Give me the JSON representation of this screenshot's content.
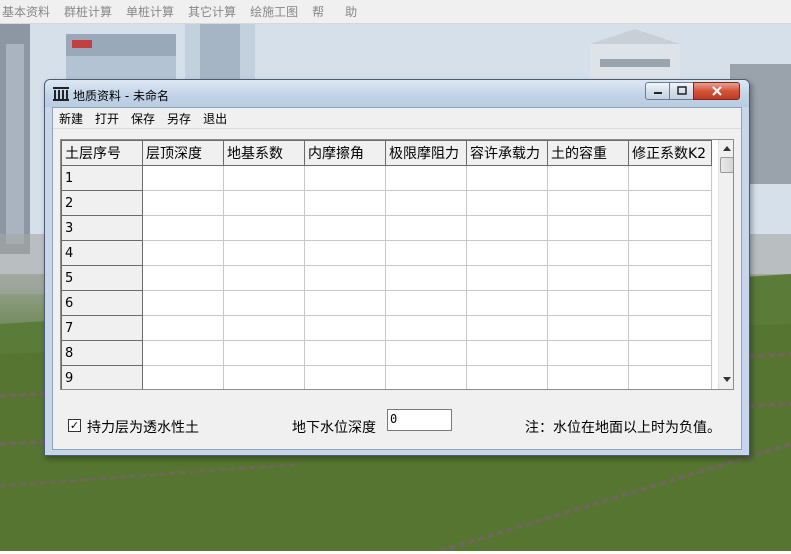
{
  "main_menu": {
    "items": [
      "基本资料",
      "群桩计算",
      "单桩计算",
      "其它计算",
      "绘施工图",
      "帮",
      "助"
    ]
  },
  "dialog": {
    "title": "地质资料 - 未命名",
    "menu": [
      "新建",
      "打开",
      "保存",
      "另存",
      "退出"
    ],
    "table": {
      "headers": [
        "土层序号",
        "层顶深度",
        "地基系数",
        "内摩擦角",
        "极限摩阻力",
        "容许承载力",
        "土的容重",
        "修正系数K2"
      ],
      "rows": [
        "1",
        "2",
        "3",
        "4",
        "5",
        "6",
        "7",
        "8",
        "9"
      ]
    },
    "checkbox": {
      "label": "持力层为透水性土",
      "checked": true,
      "mark": "✓"
    },
    "groundwater": {
      "label": "地下水位深度",
      "value": "0"
    },
    "note": "注：水位在地面以上时为负值。"
  },
  "colors": {
    "titlebar": "#c3d4e8",
    "close_button": "#d2543a",
    "grass": "#5f7f3f",
    "sky": "#d9e3ee"
  }
}
